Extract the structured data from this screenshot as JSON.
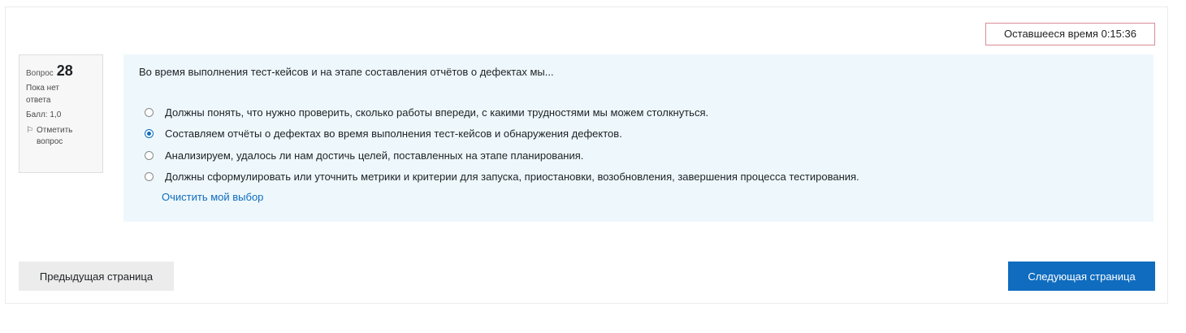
{
  "timer": {
    "text": "Оставшееся время 0:15:36"
  },
  "question_info": {
    "number_label": "Вопрос",
    "number": "28",
    "state_line1": "Пока нет",
    "state_line2": "ответа",
    "grade": "Балл: 1,0",
    "flag_icon": "flag-icon",
    "flag_line1": "Отметить",
    "flag_line2": "вопрос"
  },
  "question": {
    "text": "Во время выполнения тест-кейсов и на этапе составления отчётов о дефектах мы...",
    "answers": [
      {
        "label": "Должны понять, что нужно проверить, сколько работы впереди, с какими трудностями мы можем столкнуться.",
        "selected": false
      },
      {
        "label": "Составляем отчёты о дефектах во время выполнения тест-кейсов и обнаружения дефектов.",
        "selected": true
      },
      {
        "label": "Анализируем, удалось ли нам достичь целей, поставленных на этапе планирования.",
        "selected": false
      },
      {
        "label": "Должны сформулировать или уточнить метрики и критерии для запуска, приостановки, возобновления, завершения процесса тестирования.",
        "selected": false
      }
    ],
    "clear_choice": "Очистить мой выбор"
  },
  "navigation": {
    "prev_label": "Предыдущая страница",
    "next_label": "Следующая страница"
  },
  "colors": {
    "primary": "#0f6cbf",
    "question_bg": "#eef8fc",
    "timer_border": "#d98b95"
  }
}
